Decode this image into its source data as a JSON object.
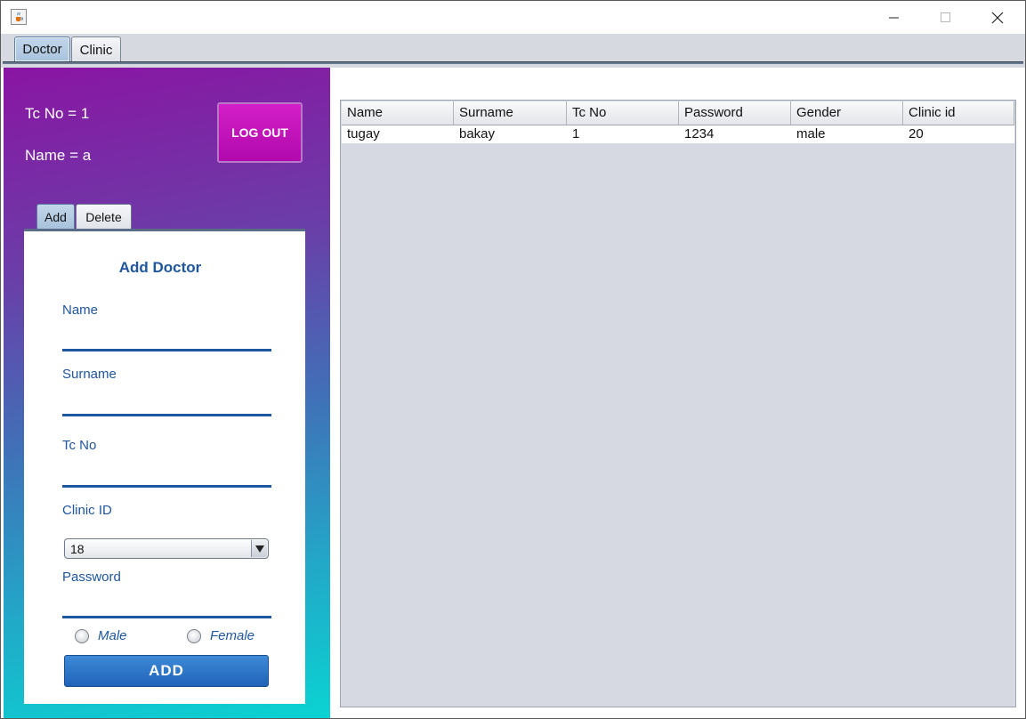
{
  "window": {
    "icon": "java-cup-icon",
    "controls": {
      "minimize": "minimize-icon",
      "maximize": "maximize-icon",
      "close": "close-icon"
    }
  },
  "tabs": [
    {
      "label": "Doctor",
      "active": true
    },
    {
      "label": "Clinic",
      "active": false
    }
  ],
  "user_info": {
    "tc_no": "Tc No = 1",
    "name": "Name = a"
  },
  "logout_label": "LOG OUT",
  "inner_tabs": [
    {
      "label": "Add",
      "active": true
    },
    {
      "label": "Delete",
      "active": false
    }
  ],
  "form": {
    "title": "Add Doctor",
    "name_label": "Name",
    "name_value": "",
    "surname_label": "Surname",
    "surname_value": "",
    "tcno_label": "Tc No",
    "tcno_value": "",
    "clinic_label": "Clinic ID",
    "clinic_selected": "18",
    "password_label": "Password",
    "password_value": "",
    "gender_male": "Male",
    "gender_female": "Female",
    "add_label": "ADD"
  },
  "table": {
    "headers": [
      "Name",
      "Surname",
      "Tc No",
      "Password",
      "Gender",
      "Clinic id"
    ],
    "rows": [
      [
        "tugay",
        "bakay",
        "1",
        "1234",
        "male",
        "20"
      ]
    ]
  },
  "colors": {
    "accent_blue": "#1e56a0",
    "logout_magenta": "#c013b8",
    "gradient_top": "#8a15a3",
    "gradient_bottom": "#0ad3d2"
  }
}
